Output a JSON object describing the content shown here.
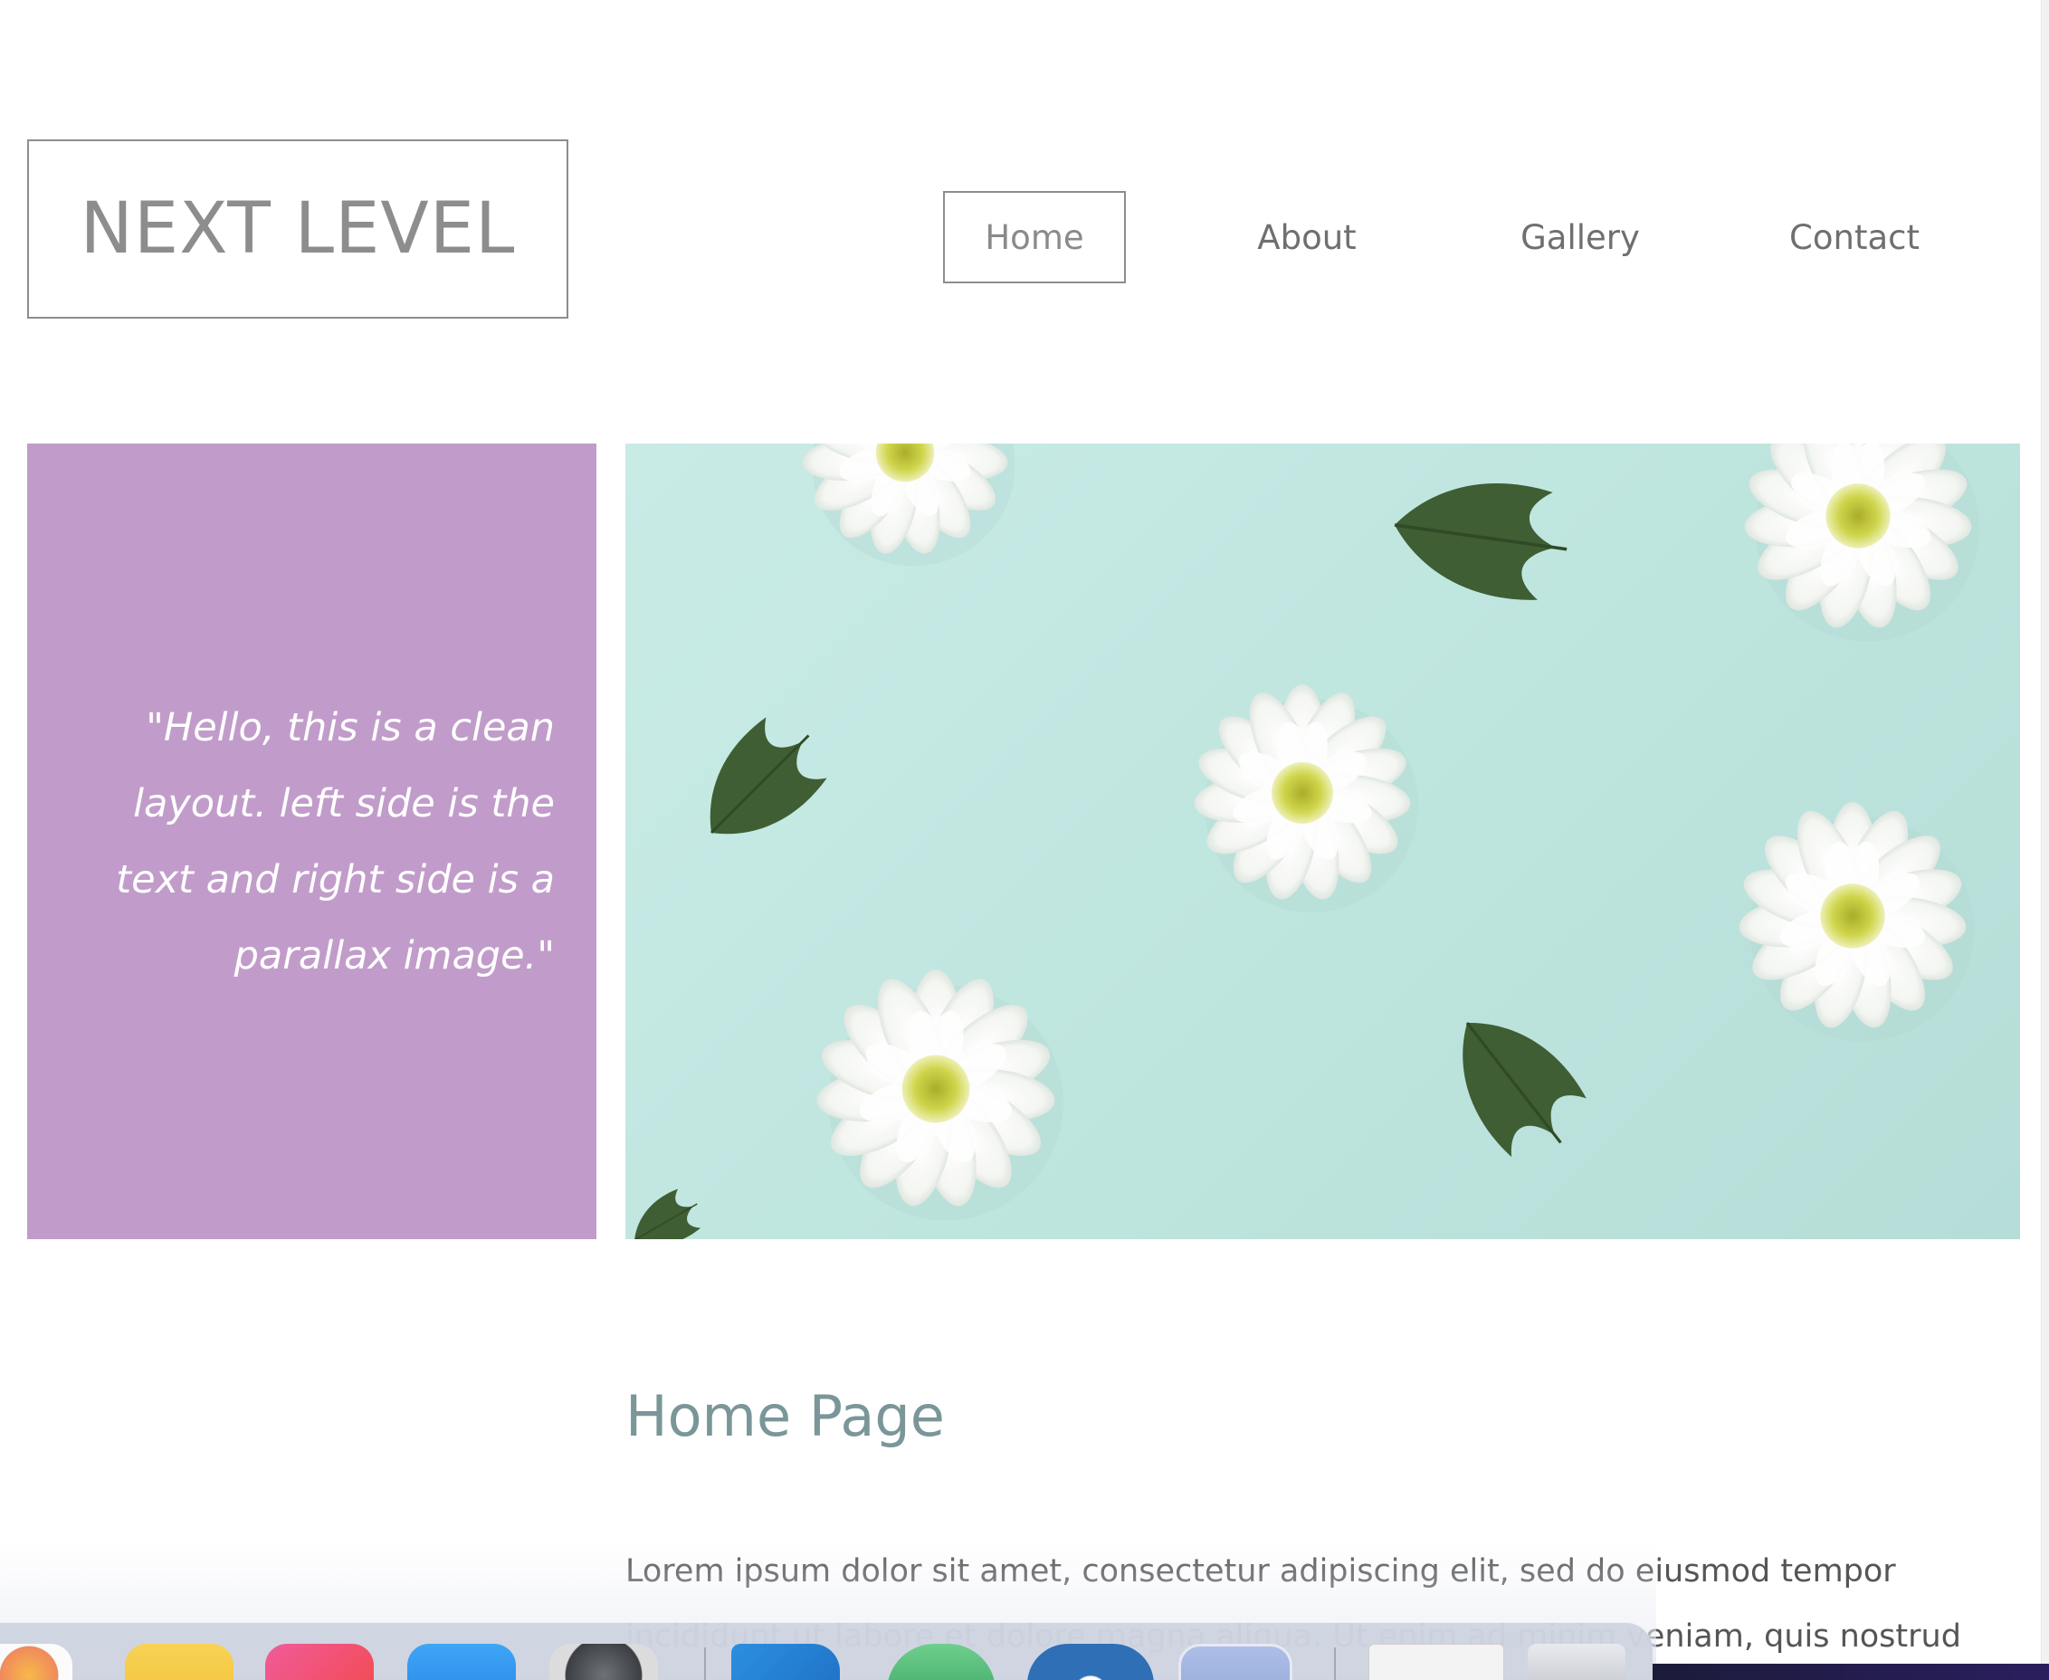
{
  "header": {
    "logo_text": "NEXT LEVEL",
    "nav": [
      {
        "label": "Home",
        "active": true
      },
      {
        "label": "About",
        "active": false
      },
      {
        "label": "Gallery",
        "active": false
      },
      {
        "label": "Contact",
        "active": false
      }
    ]
  },
  "quote_panel": {
    "text": "\"Hello, this is a clean layout. left side is the text and right side is a parallax image.\"",
    "background": "#c19cca"
  },
  "hero": {
    "image": "white-daisies-on-mint-background"
  },
  "main": {
    "heading": "Home Page",
    "body": "Lorem ipsum dolor sit amet, consectetur adipiscing elit, sed do eiusmod tempor incididunt ut labore et dolore magna aliqua. Ut enim ad minim veniam, quis nostrud exercitation"
  },
  "dock": {
    "apps": [
      "photos-icon",
      "notes-icon",
      "instagram-icon",
      "app-store-icon",
      "system-preferences-icon",
      "vscode-icon",
      "android-studio-icon",
      "app-circle-icon",
      "preview-icon",
      "document-thumbnail-icon",
      "trash-icon"
    ]
  },
  "colors": {
    "accent_purple": "#c19cca",
    "heading": "#7a9698",
    "nav_border": "#8d8d8d",
    "hero_background": "#c9ebe6"
  }
}
